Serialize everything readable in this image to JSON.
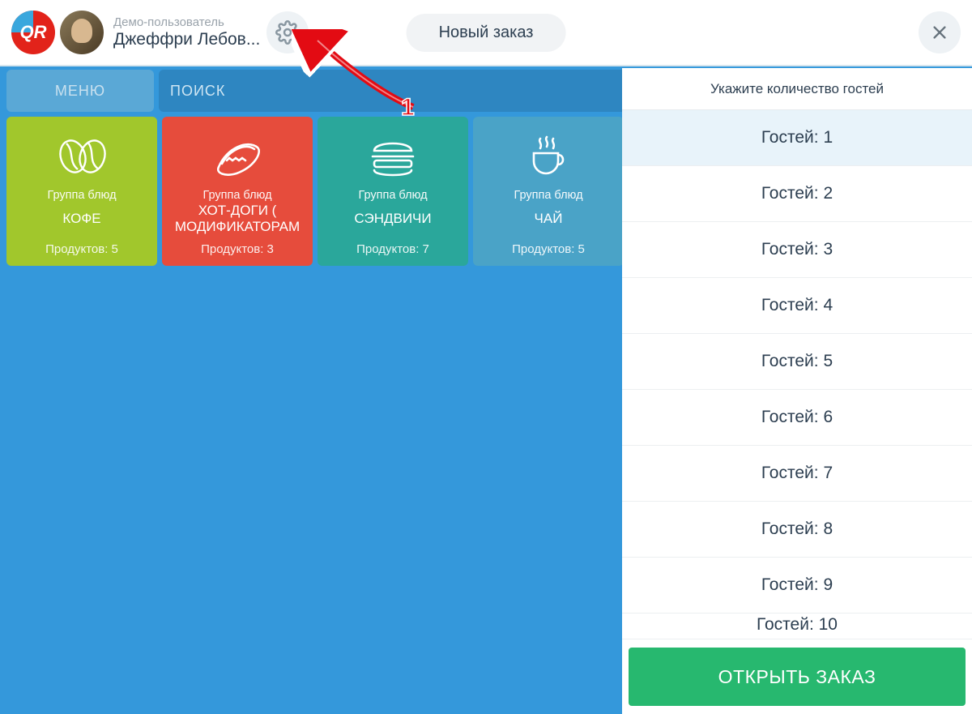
{
  "header": {
    "logo_text": "QR",
    "user_role": "Демо-пользователь",
    "user_name": "Джеффри Лебов...",
    "new_order": "Новый заказ"
  },
  "toolbar": {
    "menu_label": "МЕНЮ",
    "search_placeholder": "ПОИСК"
  },
  "tiles": [
    {
      "color": "green",
      "icon": "coffee-bean",
      "label": "Группа блюд",
      "title": "КОФЕ",
      "count": "Продуктов: 5"
    },
    {
      "color": "red",
      "icon": "hotdog",
      "label": "Группа блюд",
      "title": "ХОТ-ДОГИ ( МОДИФИКАТОРАМ",
      "count": "Продуктов: 3"
    },
    {
      "color": "teal",
      "icon": "burger",
      "label": "Группа блюд",
      "title": "СЭНДВИЧИ",
      "count": "Продуктов: 7"
    },
    {
      "color": "blue",
      "icon": "tea-cup",
      "label": "Группа блюд",
      "title": "ЧАЙ",
      "count": "Продуктов: 5"
    }
  ],
  "right": {
    "header": "Укажите количество гостей",
    "selected_index": 0,
    "guests": [
      "Гостей: 1",
      "Гостей: 2",
      "Гостей: 3",
      "Гостей: 4",
      "Гостей: 5",
      "Гостей: 6",
      "Гостей: 7",
      "Гостей: 8",
      "Гостей: 9",
      "Гостей: 10"
    ],
    "open_order": "ОТКРЫТЬ ЗАКАЗ"
  },
  "annotation": {
    "number": "1"
  }
}
